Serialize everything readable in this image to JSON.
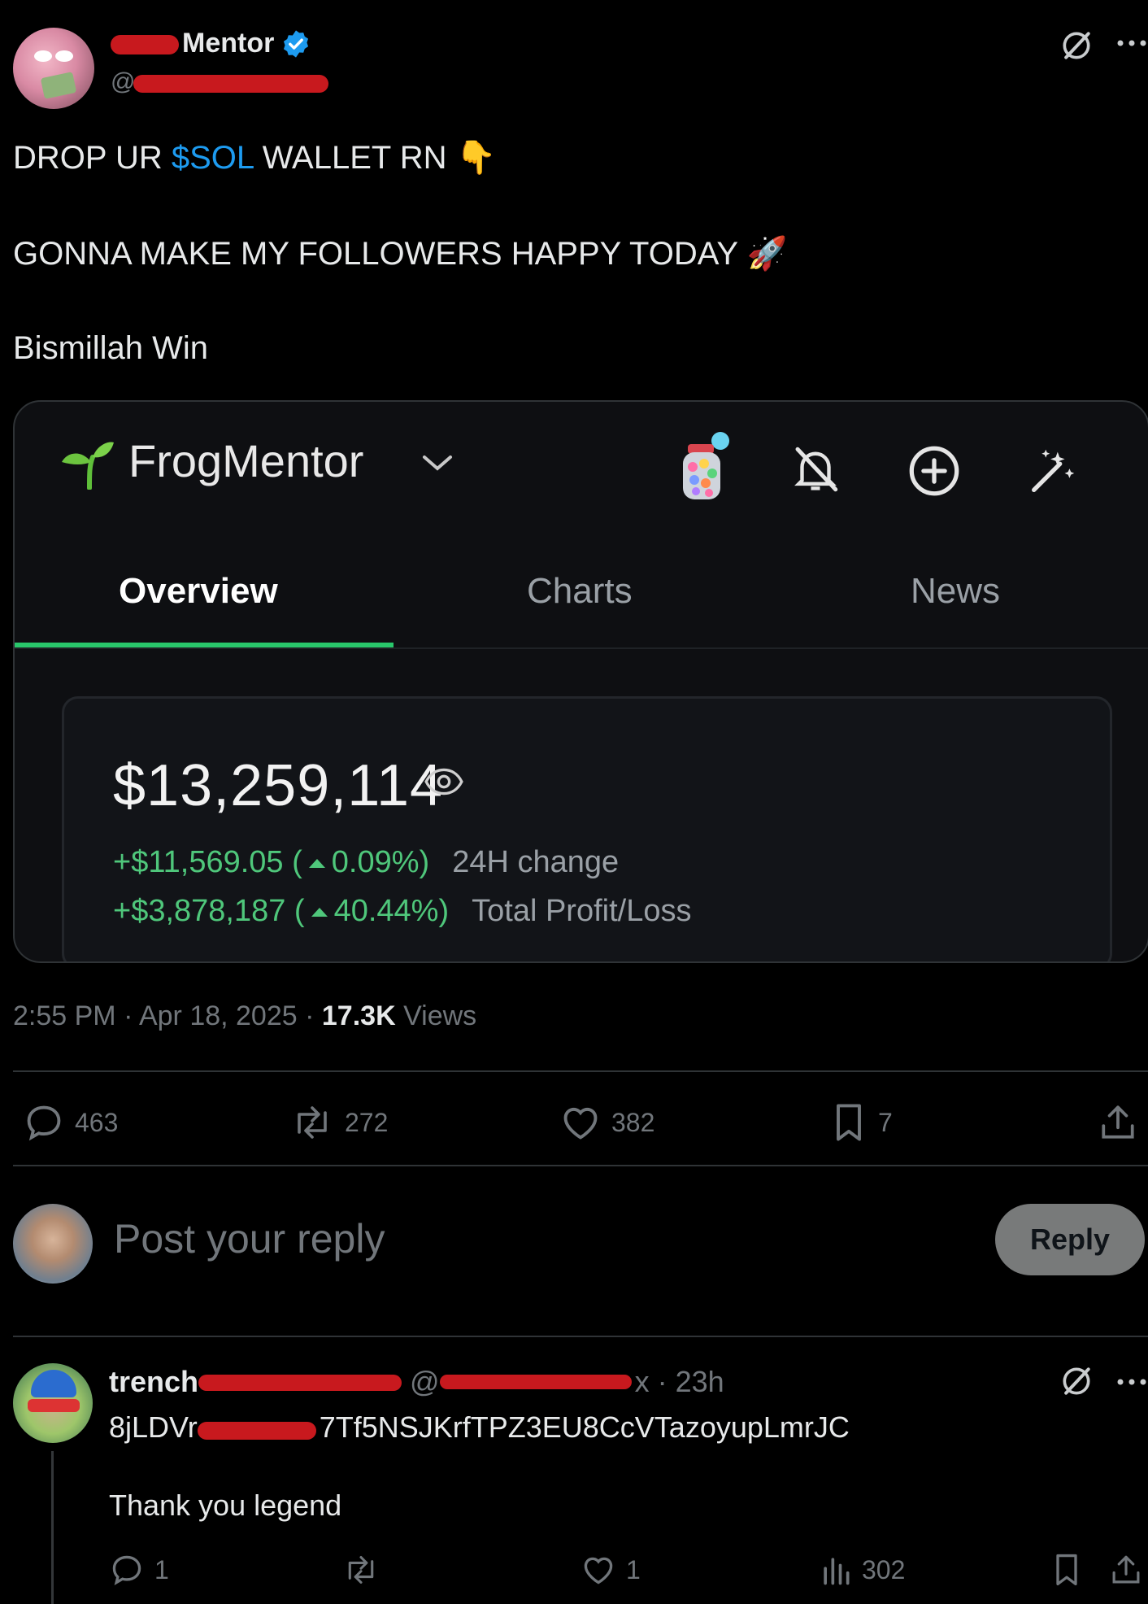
{
  "post": {
    "author_name": "Mentor",
    "author_handle": "@",
    "lines": [
      {
        "before": "DROP UR ",
        "highlight": "$SOL",
        "after": " WALLET RN 👇"
      },
      {
        "text": "GONNA MAKE MY FOLLOWERS HAPPY TODAY 🚀"
      },
      {
        "text": "Bismillah Win"
      }
    ],
    "timestamp": "2:55 PM · Apr 18, 2025 · ",
    "views_count": "17.3K",
    "views_label": " Views",
    "actions": {
      "replies": "463",
      "reposts": "272",
      "likes": "382",
      "bookmarks": "7"
    }
  },
  "embedded_app": {
    "wallet_name": "FrogMentor",
    "tabs": [
      "Overview",
      "Charts",
      "News"
    ],
    "active_tab": "Overview",
    "balance": "$13,259,114",
    "change_24h": {
      "value": "+$11,569.05 (",
      "pct": "0.09%)",
      "label": "24H change"
    },
    "total_pl": {
      "value": "+$3,878,187 (",
      "pct": "40.44%)",
      "label": "Total Profit/Loss"
    },
    "accent_color": "#29c76b"
  },
  "reply_box": {
    "placeholder": "Post your reply",
    "button_label": "Reply"
  },
  "comment": {
    "name": "trench",
    "handle_fragment": "@",
    "handle_tail": "x · 23h",
    "address": "8jLDVr",
    "address_tail": "7Tf5NSJKrfTPZ3EU8CcVTazoyupLmrJC",
    "text": "Thank you legend",
    "actions": {
      "replies": "1",
      "likes": "1",
      "views": "302"
    }
  }
}
